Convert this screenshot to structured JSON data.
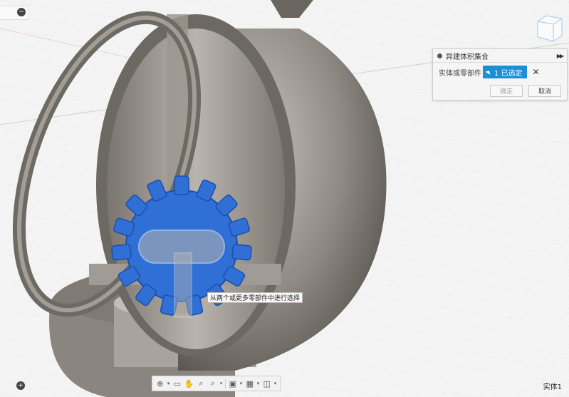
{
  "dialog": {
    "title": "异建体积集合",
    "field_label": "实体或零部件",
    "selection_label": "1 已选定",
    "ok_label": "确定",
    "cancel_label": "取消",
    "expand_icon": "double-chevron-right-icon",
    "clear_icon": "close-icon"
  },
  "tooltip": {
    "text": "从两个或更多零部件中进行选择"
  },
  "viewport": {
    "body_name": "实体1",
    "colors": {
      "gear": "#2f6fd6",
      "sphere": "#8a857e",
      "background": "#f4f4f4",
      "selection": "#1a8fd6"
    }
  },
  "toolbar": {
    "items": [
      "orbit-icon",
      "pan-icon",
      "hand-icon",
      "zoom-icon",
      "zoom-window-icon",
      "display-icon",
      "grid-icon",
      "viewports-icon"
    ]
  }
}
